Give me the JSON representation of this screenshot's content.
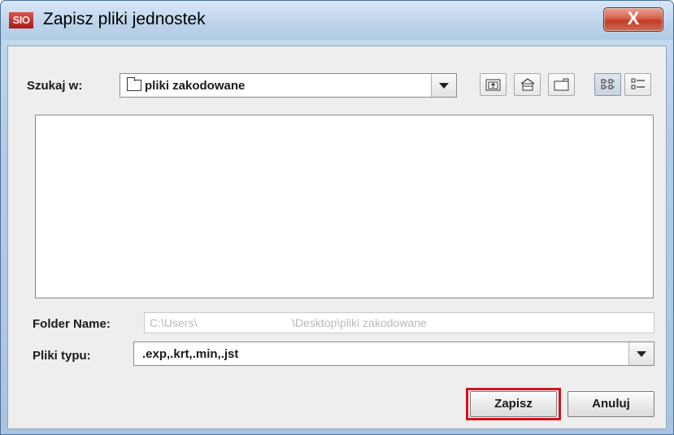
{
  "window": {
    "app_icon_text": "SIO",
    "title": "Zapisz pliki jednostek",
    "close_label": "X"
  },
  "lookin": {
    "label": "Szukaj w:",
    "value": "pliki zakodowane"
  },
  "toolbar": {
    "buttons": [
      {
        "name": "up-one-level-icon"
      },
      {
        "name": "home-icon"
      },
      {
        "name": "new-folder-icon"
      },
      {
        "name": "list-view-icon",
        "active": true
      },
      {
        "name": "details-view-icon"
      }
    ]
  },
  "folder_name": {
    "label": "Folder Name:",
    "value": "C:\\Users\\                              \\Desktop\\pliki zakodowane"
  },
  "file_type": {
    "label": "Pliki typu:",
    "value": ".exp,.krt,.min,.jst"
  },
  "actions": {
    "save_label": "Zapisz",
    "cancel_label": "Anuluj",
    "highlight_color": "#d4131f"
  }
}
